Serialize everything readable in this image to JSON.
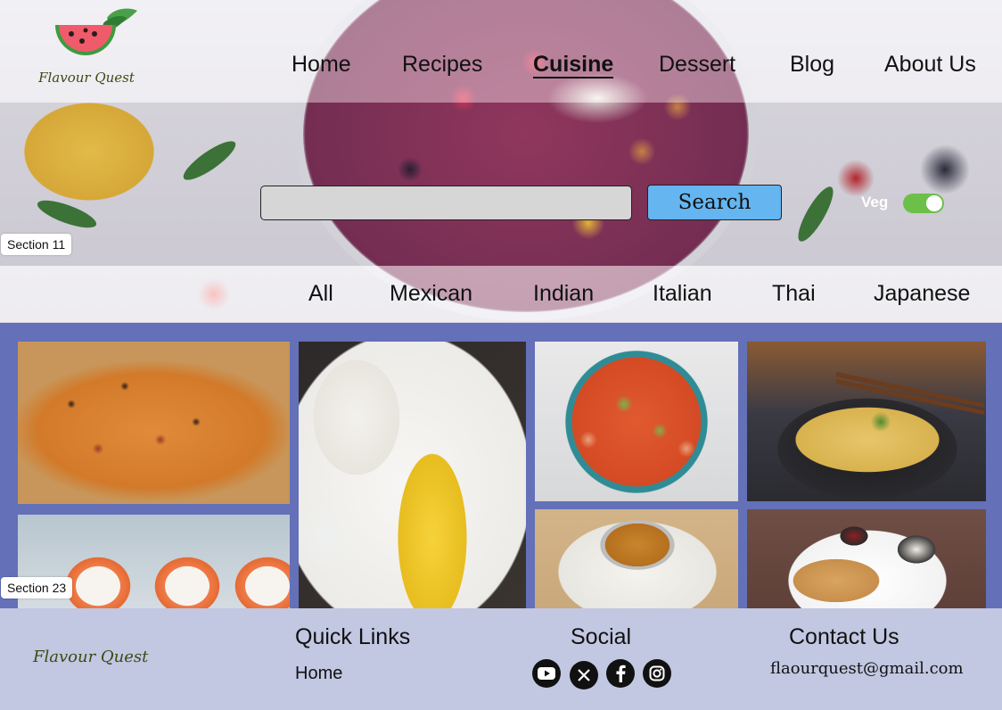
{
  "brand": {
    "name": "Flavour Quest"
  },
  "nav": {
    "items": [
      {
        "label": "Home",
        "active": false
      },
      {
        "label": "Recipes",
        "active": false
      },
      {
        "label": "Cuisine",
        "active": true
      },
      {
        "label": "Dessert",
        "active": false
      },
      {
        "label": "Blog",
        "active": false
      },
      {
        "label": "About Us",
        "active": false
      }
    ]
  },
  "search": {
    "value": "",
    "placeholder": "",
    "button_label": "Search"
  },
  "veg_toggle": {
    "label": "Veg",
    "on": true,
    "color": "#6cc04a"
  },
  "sections": {
    "hero_tag": "Section 11",
    "gallery_tag": "Section 23"
  },
  "categories": [
    "All",
    "Mexican",
    "Indian",
    "Italian",
    "Thai",
    "Japanese"
  ],
  "gallery": {
    "background": "#6470b8",
    "tiles": [
      "pizza",
      "sushi",
      "mango-sticky-rice",
      "tom-yum-soup",
      "noodles",
      "dal-rice",
      "paratha"
    ]
  },
  "footer": {
    "brand": "Flavour Quest",
    "quick_links": {
      "heading": "Quick Links",
      "links": [
        "Home"
      ]
    },
    "social": {
      "heading": "Social",
      "icons": [
        "youtube-icon",
        "x-icon",
        "facebook-icon",
        "instagram-icon"
      ]
    },
    "contact": {
      "heading": "Contact Us",
      "email": "flaourquest@gmail.com"
    },
    "background": "#c2c7e2"
  },
  "colors": {
    "search_button": "#64b5f0",
    "logo_text": "#3b4a12"
  }
}
